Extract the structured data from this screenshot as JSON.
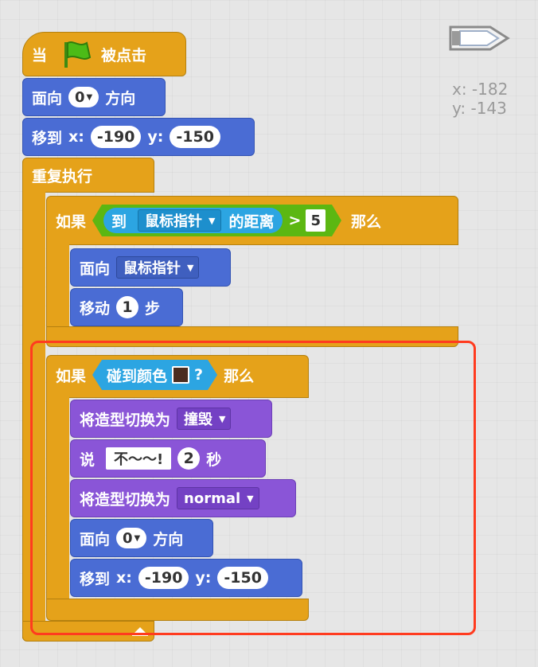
{
  "colors": {
    "events": "#e5a21a",
    "control": "#e5a21a",
    "motion": "#4a6cd4",
    "looks": "#8a55d7",
    "sensing": "#2ca5e2",
    "operators": "#5cb712",
    "highlight": "#ff3b1f",
    "touch_color": "#4b2d20"
  },
  "sprite": {
    "thumbnail_icon": "boat-sprite-icon",
    "x_label": "x: -182",
    "y_label": "y: -143"
  },
  "script": {
    "hat": {
      "when": "当",
      "flag_icon": "green-flag-icon",
      "clicked": "被点击"
    },
    "point1": {
      "label": "面向",
      "value": "0",
      "suffix": "方向"
    },
    "goto1": {
      "label": "移到",
      "x_label": "x:",
      "x": "-190",
      "y_label": "y:",
      "y": "-150"
    },
    "forever": {
      "label": "重复执行"
    },
    "if1": {
      "if_label": "如果",
      "dist_label": "到",
      "dist_target": "鼠标指针",
      "dist_suffix": "的距离",
      "op": ">",
      "op_value": "5",
      "then_label": "那么",
      "point_label": "面向",
      "point_target": "鼠标指针",
      "move_label": "移动",
      "move_value": "1",
      "move_suffix": "步"
    },
    "if2": {
      "if_label": "如果",
      "touch_label": "碰到颜色",
      "touch_q": "?",
      "then_label": "那么",
      "costume1_label": "将造型切换为",
      "costume1_value": "撞毁",
      "say_label": "说",
      "say_text": "不～～!",
      "say_secs": "2",
      "say_suffix": "秒",
      "costume2_label": "将造型切换为",
      "costume2_value": "normal",
      "point_label": "面向",
      "point_value": "0",
      "point_suffix": "方向",
      "goto_label": "移到",
      "goto_x_label": "x:",
      "goto_x": "-190",
      "goto_y_label": "y:",
      "goto_y": "-150"
    }
  }
}
